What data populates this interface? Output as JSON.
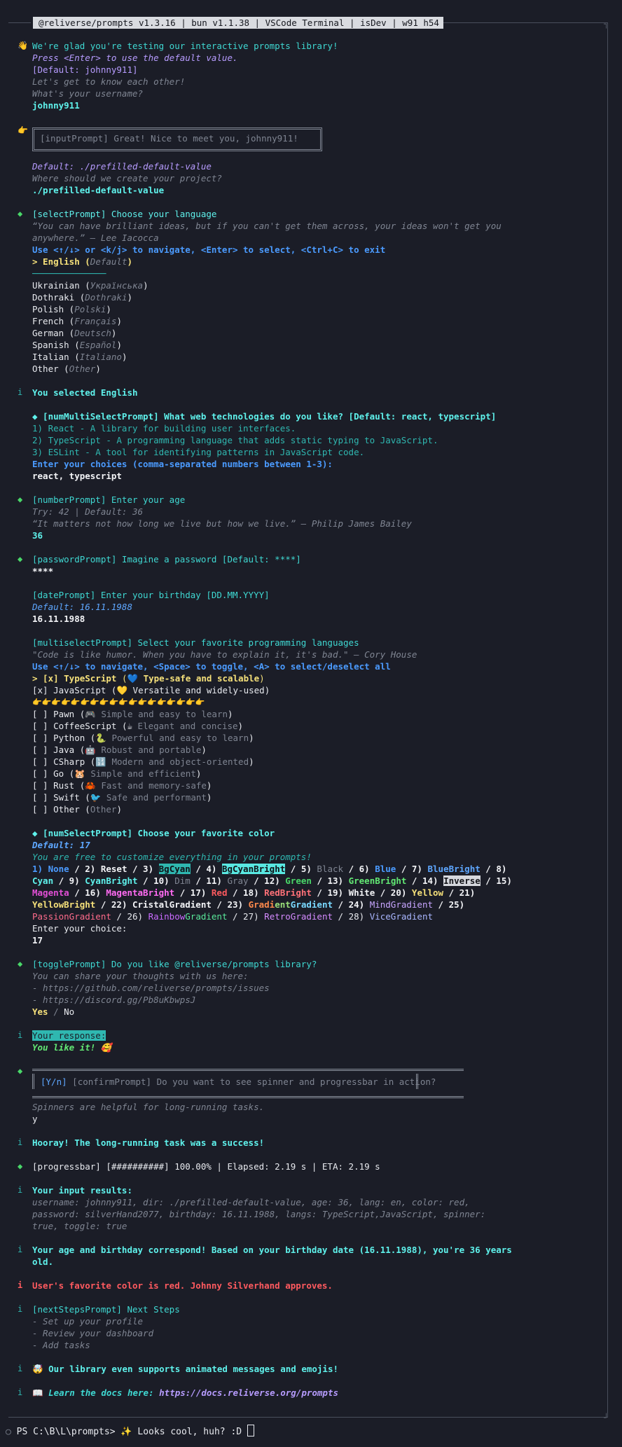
{
  "header": {
    "text": "@reliverse/prompts v1.3.16 | bun v1.1.38 | VSCode Terminal | isDev | w91 h54"
  },
  "icons": {
    "wave": "👋",
    "point": "👉",
    "diamond": "◆",
    "info": "i",
    "circle": "○"
  },
  "intro": {
    "welcome": "We're glad you're testing our interactive prompts library!",
    "hint": "Press <Enter> to use the default value.",
    "default": "[Default: johnny911]",
    "know": "Let's get to know each other!",
    "question": "What's your username?",
    "answer": "johnny911"
  },
  "greeting_box": "[inputPrompt] Great! Nice to meet you, johnny911!",
  "project": {
    "default": "Default: ./prefilled-default-value",
    "question": "Where should we create your project?",
    "answer": "./prefilled-default-value"
  },
  "language": {
    "title": "[selectPrompt] Choose your language",
    "quote1": "“You can have brilliant ideas, but if you can't get them across, your ideas won't get you",
    "quote2": "anywhere.” – Lee Iacocca",
    "nav": "Use <↑/↓> or <k/j> to navigate, <Enter> to select, <Ctrl+C> to exit",
    "selected_prefix": "> English (",
    "selected_native": "Default",
    "selected_suffix": ")",
    "separator": "──────────────",
    "options": [
      {
        "name": "Ukrainian",
        "native": "Українська"
      },
      {
        "name": "Dothraki",
        "native": "Dothraki"
      },
      {
        "name": "Polish",
        "native": "Polski"
      },
      {
        "name": "French",
        "native": "Français"
      },
      {
        "name": "German",
        "native": "Deutsch"
      },
      {
        "name": "Spanish",
        "native": "Español"
      },
      {
        "name": "Italian",
        "native": "Italiano"
      },
      {
        "name": "Other",
        "native": "Other"
      }
    ],
    "result": "You selected English"
  },
  "tech": {
    "title": "◆ [numMultiSelectPrompt] What web technologies do you like? [Default: react, typescript]",
    "items": [
      "1) React - A library for building user interfaces.",
      "2) TypeScript - A programming language that adds static typing to JavaScript.",
      "3) ESLint - A tool for identifying patterns in JavaScript code."
    ],
    "instruction": "Enter your choices (comma-separated numbers between 1-3):",
    "answer": "react, typescript"
  },
  "age": {
    "title": "[numberPrompt] Enter your age",
    "hint": "Try: 42 | Default: 36",
    "quote": "“It matters not how long we live but how we live.” – Philip James Bailey",
    "answer": "36"
  },
  "password": {
    "title": "[passwordPrompt] Imagine a password [Default: ****]",
    "answer": "****"
  },
  "birthday": {
    "title": "[datePrompt] Enter your birthday [DD.MM.YYYY]",
    "default": "Default: 16.11.1988",
    "answer": "16.11.1988"
  },
  "langs": {
    "title": "[multiselectPrompt] Select your favorite programming languages",
    "quote": "\"Code is like humor. When you have to explain it, it's bad.\" – Cory House",
    "nav": "Use <↑/↓> to navigate, <Space> to toggle, <A> to select/deselect all",
    "selected": [
      {
        "prefix": "> [x] ",
        "name": "TypeScript",
        "emoji": "💙",
        "desc": "Type-safe and scalable"
      },
      {
        "prefix": "[x] ",
        "name": "JavaScript",
        "emoji": "💛",
        "desc": "Versatile and widely-used"
      }
    ],
    "divider": "👉👉👉👉👉👉👉👉👉👉👉👉👉👉👉👉👉👉",
    "options": [
      {
        "name": "Pawn",
        "emoji": "🎮",
        "desc": "Simple and easy to learn"
      },
      {
        "name": "CoffeeScript",
        "emoji": "☕",
        "desc": "Elegant and concise"
      },
      {
        "name": "Python",
        "emoji": "🐍",
        "desc": "Powerful and easy to learn"
      },
      {
        "name": "Java",
        "emoji": "🤖",
        "desc": "Robust and portable"
      },
      {
        "name": "CSharp",
        "emoji": "🔢",
        "desc": "Modern and object-oriented"
      },
      {
        "name": "Go",
        "emoji": "🐹",
        "desc": "Simple and efficient"
      },
      {
        "name": "Rust",
        "emoji": "🦀",
        "desc": "Fast and memory-safe"
      },
      {
        "name": "Swift",
        "emoji": "🐦",
        "desc": "Safe and performant"
      },
      {
        "name": "Other",
        "emoji": "",
        "desc": "Other"
      }
    ]
  },
  "color": {
    "title": "◆ [numSelectPrompt] Choose your favorite color",
    "default": "Default: 17",
    "hint": "You are free to customize everything in your prompts!",
    "prompt": "Enter your choice:",
    "answer": "17"
  },
  "toggle": {
    "title": "[togglePrompt] Do you like @reliverse/prompts library?",
    "share": "You can share your thoughts with us here:",
    "link1": "- https://github.com/reliverse/prompts/issues",
    "link2": "- https://discord.gg/Pb8uKbwpsJ",
    "yes": "Yes",
    "sep": " / ",
    "no": "No",
    "response_label": "Your response:",
    "response": "You like it! 🥰"
  },
  "confirm": {
    "yn": "[Y/n]",
    "text": " [confirmPrompt] Do you want to see spinner and progressbar in action?",
    "hint": "Spinners are helpful for long-running tasks.",
    "answer": "y"
  },
  "task": {
    "success": "Hooray! The long-running task was a success!"
  },
  "progress": {
    "text": "[progressbar] [##########] 100.00% | Elapsed: 2.19 s | ETA: 2.19 s",
    "percent": 100
  },
  "results": {
    "title": "Your input results:",
    "line1": "username: johnny911, dir: ./prefilled-default-value, age: 36, lang: en, color: red,",
    "line2": "password: silverHand2077, birthday: 16.11.1988, langs: TypeScript,JavaScript, spinner:",
    "line3": "true, toggle: true"
  },
  "agecheck": {
    "line1": "Your age and birthday correspond! Based on your birthday date (16.11.1988), you're 36 years",
    "line2": "old."
  },
  "favorite": "User's favorite color is red. Johnny Silverhand approves.",
  "next": {
    "title": "[nextStepsPrompt] Next Steps",
    "steps": [
      "- Set up your profile",
      "- Review your dashboard",
      "- Add tasks"
    ]
  },
  "animated": "🤯 Our library even supports animated messages and emojis!",
  "docs": {
    "prefix": "📖 ",
    "label": "Learn the docs here: ",
    "url": "https://docs.reliverse.org/prompts"
  },
  "shell": {
    "prompt": "PS C:\\B\\L\\prompts> ",
    "message": "✨ Looks cool, huh? :D "
  },
  "colors": {
    "background": "#1b1d27",
    "cyan": "#3fd8d2",
    "blue": "#5ea7ff",
    "red": "#ff5a5f"
  }
}
